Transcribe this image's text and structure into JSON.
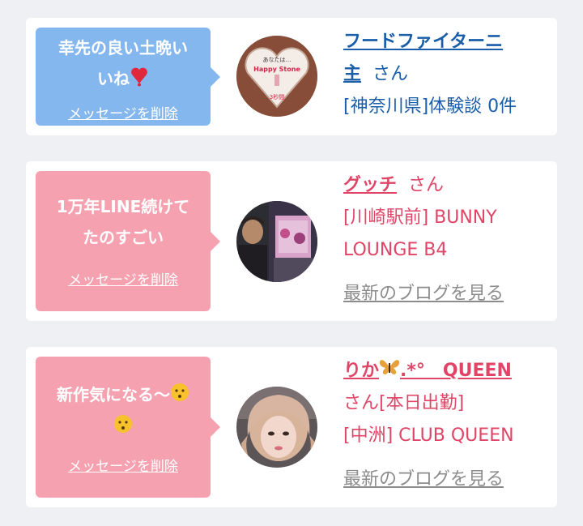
{
  "colors": {
    "background": "#eff0f4",
    "bubble_blue": "#85b7ef",
    "bubble_pink": "#f6a1b0",
    "link_blue": "#1a5da8",
    "link_pink": "#e04567",
    "muted": "#8c8c8c"
  },
  "cards": [
    {
      "bubble_color": "blue",
      "message_lines": [
        "幸先の良い土晩い",
        "いね"
      ],
      "message_emoji": "heart-exclamation-icon",
      "delete_label": "メッセージを削除",
      "name_line1": "フードファイターニ",
      "name_line2": "主",
      "honorific": "さん",
      "detail_lines": [
        "[神奈川県]体験談 0件"
      ],
      "blog_label": "",
      "avatar_icon": "heart-stone-photo"
    },
    {
      "bubble_color": "pink",
      "message_lines": [
        "1万年LINE続けて",
        "たのすごい"
      ],
      "delete_label": "メッセージを削除",
      "name": "グッチ",
      "honorific": "さん",
      "detail_lines": [
        "[川崎駅前] BUNNY",
        "LOUNGE B4"
      ],
      "blog_label": "最新のブログを見る",
      "avatar_icon": "man-photo"
    },
    {
      "bubble_color": "pink",
      "message_lines": [
        "新作気になる〜",
        ""
      ],
      "message_emoji": "kissing-face-icon",
      "delete_label": "メッセージを削除",
      "name": "りか",
      "name_suffix": ".*°　QUEEN",
      "name_emoji": "butterfly-icon",
      "honorific_line": "さん[本日出勤]",
      "detail_lines": [
        "[中洲] CLUB QUEEN"
      ],
      "blog_label": "最新のブログを見る",
      "avatar_icon": "woman-photo"
    }
  ]
}
